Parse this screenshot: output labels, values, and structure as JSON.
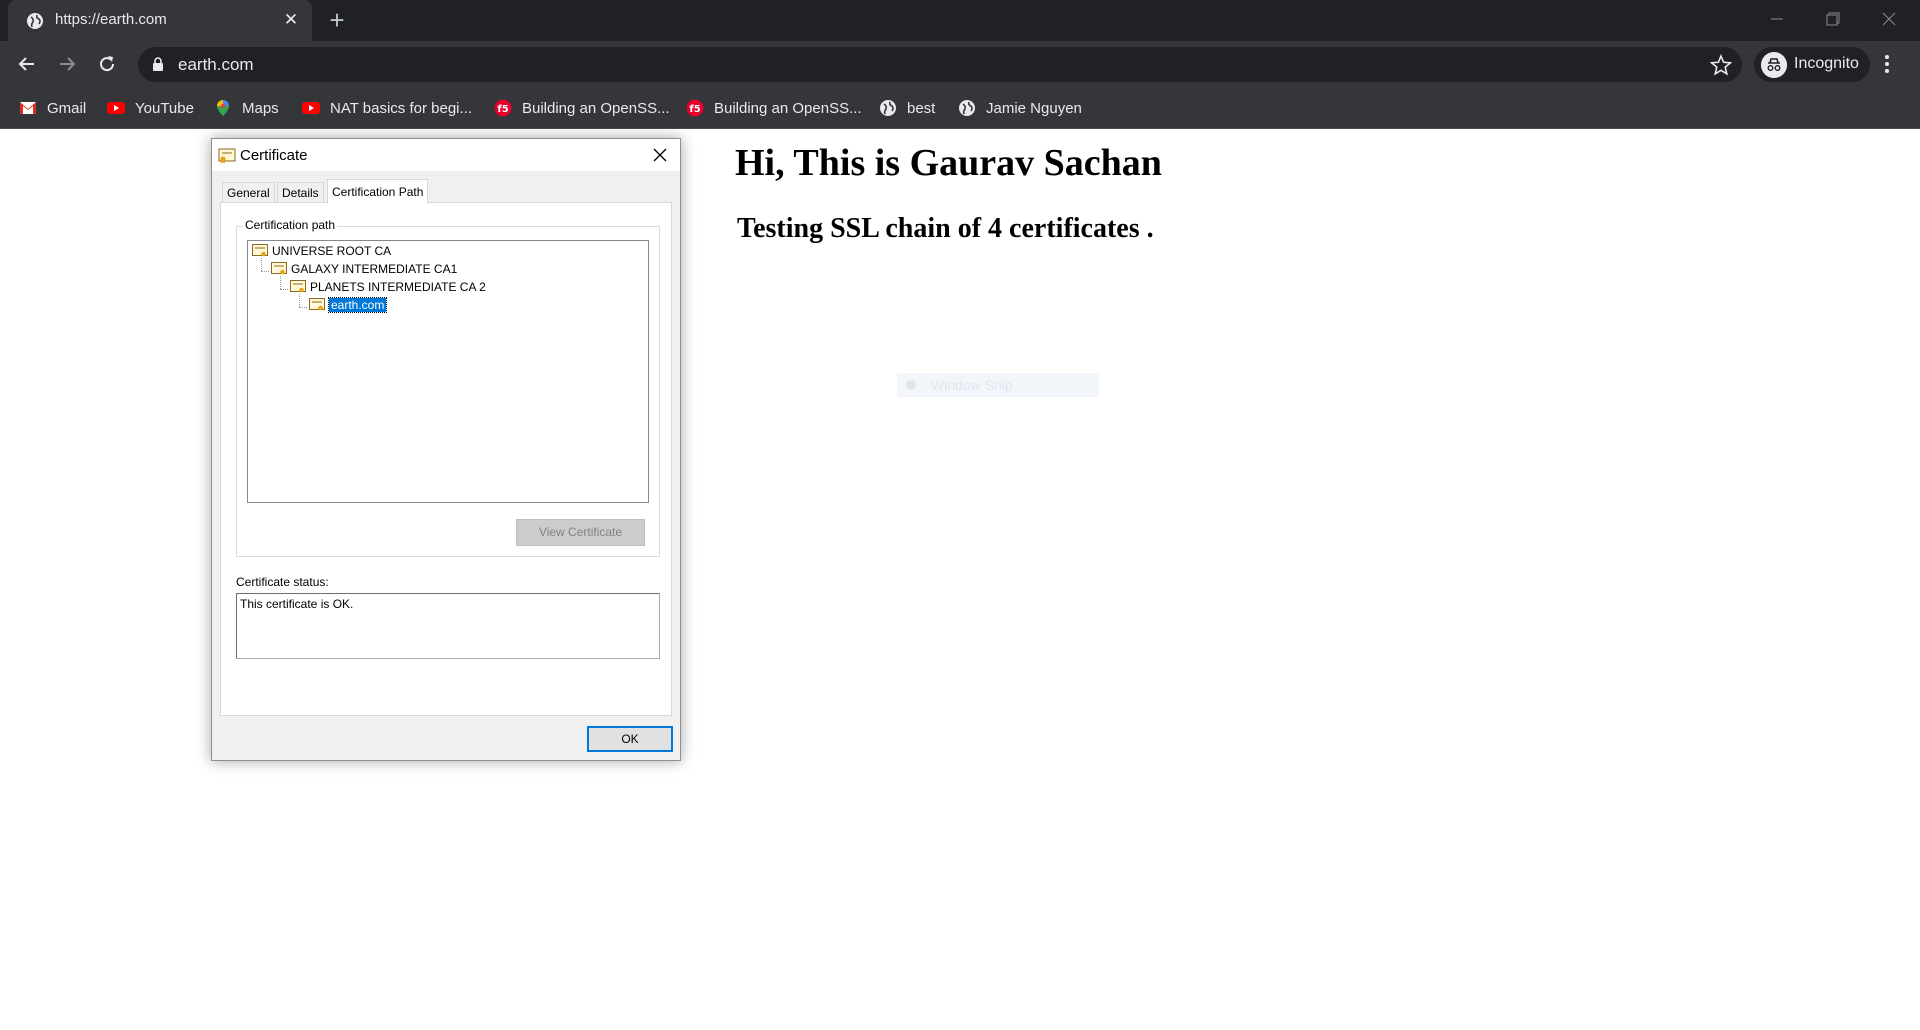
{
  "browser": {
    "tab": {
      "title": "https://earth.com",
      "favicon": "globe-icon"
    },
    "address_bar": {
      "url": "earth.com"
    },
    "profile": {
      "label": "Incognito"
    },
    "bookmarks": [
      {
        "label": "Gmail",
        "icon": "gmail-icon"
      },
      {
        "label": "YouTube",
        "icon": "youtube-icon"
      },
      {
        "label": "Maps",
        "icon": "maps-icon"
      },
      {
        "label": "NAT basics for begi...",
        "icon": "youtube-icon"
      },
      {
        "label": "Building an OpenSS...",
        "icon": "f5-icon"
      },
      {
        "label": "Building an OpenSS...",
        "icon": "f5-icon"
      },
      {
        "label": "best",
        "icon": "globe-icon"
      },
      {
        "label": "Jamie Nguyen",
        "icon": "globe-icon"
      }
    ]
  },
  "page": {
    "heading": "Hi, This is Gaurav Sachan",
    "subheading": "Testing SSL chain of 4 certificates .",
    "ghost_overlay": "Window Snip"
  },
  "dialog": {
    "title": "Certificate",
    "tabs": [
      {
        "label": "General"
      },
      {
        "label": "Details"
      },
      {
        "label": "Certification Path"
      }
    ],
    "active_tab": "Certification Path",
    "path_group_label": "Certification path",
    "path": [
      {
        "label": "UNIVERSE ROOT CA"
      },
      {
        "label": "GALAXY INTERMEDIATE CA1"
      },
      {
        "label": "PLANETS INTERMEDIATE CA 2"
      },
      {
        "label": "earth.com"
      }
    ],
    "view_certificate_label": "View Certificate",
    "status_label": "Certificate status:",
    "status_text": "This certificate is OK.",
    "ok_label": "OK"
  },
  "colors": {
    "chrome_dark": "#202124",
    "chrome_toolbar": "#35363a",
    "selection_blue": "#0078d7"
  }
}
